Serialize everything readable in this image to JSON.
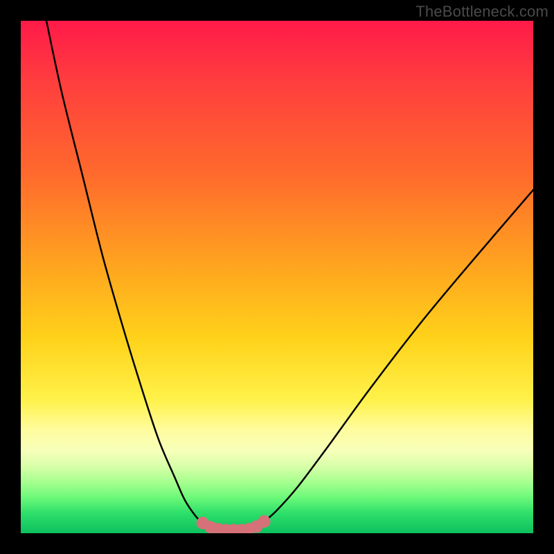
{
  "watermark": {
    "text": "TheBottleneck.com"
  },
  "colors": {
    "frame": "#000000",
    "curve_stroke": "#000000",
    "marker_fill": "#d67079",
    "marker_stroke": "#c45a64"
  },
  "chart_data": {
    "type": "line",
    "title": "",
    "xlabel": "",
    "ylabel": "",
    "xlim": [
      0,
      100
    ],
    "ylim": [
      0,
      100
    ],
    "grid": false,
    "legend": false,
    "note": "Values estimated from pixel positions; y = 0 at bottom, 100 at top.",
    "series": [
      {
        "name": "left-branch",
        "x": [
          5,
          8,
          12,
          16,
          20,
          24,
          27,
          30,
          32,
          34,
          35.5,
          37,
          38.5
        ],
        "y": [
          100,
          86,
          70,
          54,
          40,
          27,
          18,
          11,
          6.5,
          3.5,
          2,
          1.2,
          0.8
        ]
      },
      {
        "name": "valley-floor",
        "x": [
          38.5,
          40,
          41.5,
          43,
          44.5
        ],
        "y": [
          0.8,
          0.6,
          0.6,
          0.6,
          0.8
        ]
      },
      {
        "name": "right-branch",
        "x": [
          44.5,
          46,
          47.5,
          50,
          54,
          60,
          68,
          78,
          88,
          100
        ],
        "y": [
          0.8,
          1.3,
          2.3,
          4.5,
          9,
          17,
          28,
          41,
          53,
          67
        ]
      }
    ],
    "markers": {
      "name": "valley-markers",
      "x": [
        35.5,
        37,
        38.5,
        40,
        41.5,
        43,
        44.5,
        46,
        47.5
      ],
      "y": [
        2,
        1.2,
        0.8,
        0.6,
        0.6,
        0.6,
        0.8,
        1.3,
        2.3
      ],
      "radius_px": 9
    }
  }
}
